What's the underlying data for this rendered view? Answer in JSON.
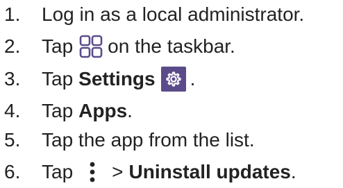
{
  "steps": [
    {
      "number": "1.",
      "text": "Log in as a local administrator."
    },
    {
      "number": "2.",
      "before": "Tap",
      "icon": "apps-grid-icon",
      "after": "on the taskbar."
    },
    {
      "number": "3.",
      "before": "Tap",
      "bold": "Settings",
      "icon": "settings-gear-icon",
      "after": "."
    },
    {
      "number": "4.",
      "before": "Tap",
      "bold": "Apps",
      "after": "."
    },
    {
      "number": "5.",
      "text": "Tap the app from the list."
    },
    {
      "number": "6.",
      "before": "Tap",
      "icon": "more-options-icon",
      "middle": ">",
      "bold": "Uninstall updates",
      "after": "."
    }
  ],
  "colors": {
    "text": "#222222",
    "apps_icon": "#5b4b8a",
    "settings_icon_bg": "#5b4b8a",
    "settings_icon_fg": "#ffffff"
  }
}
